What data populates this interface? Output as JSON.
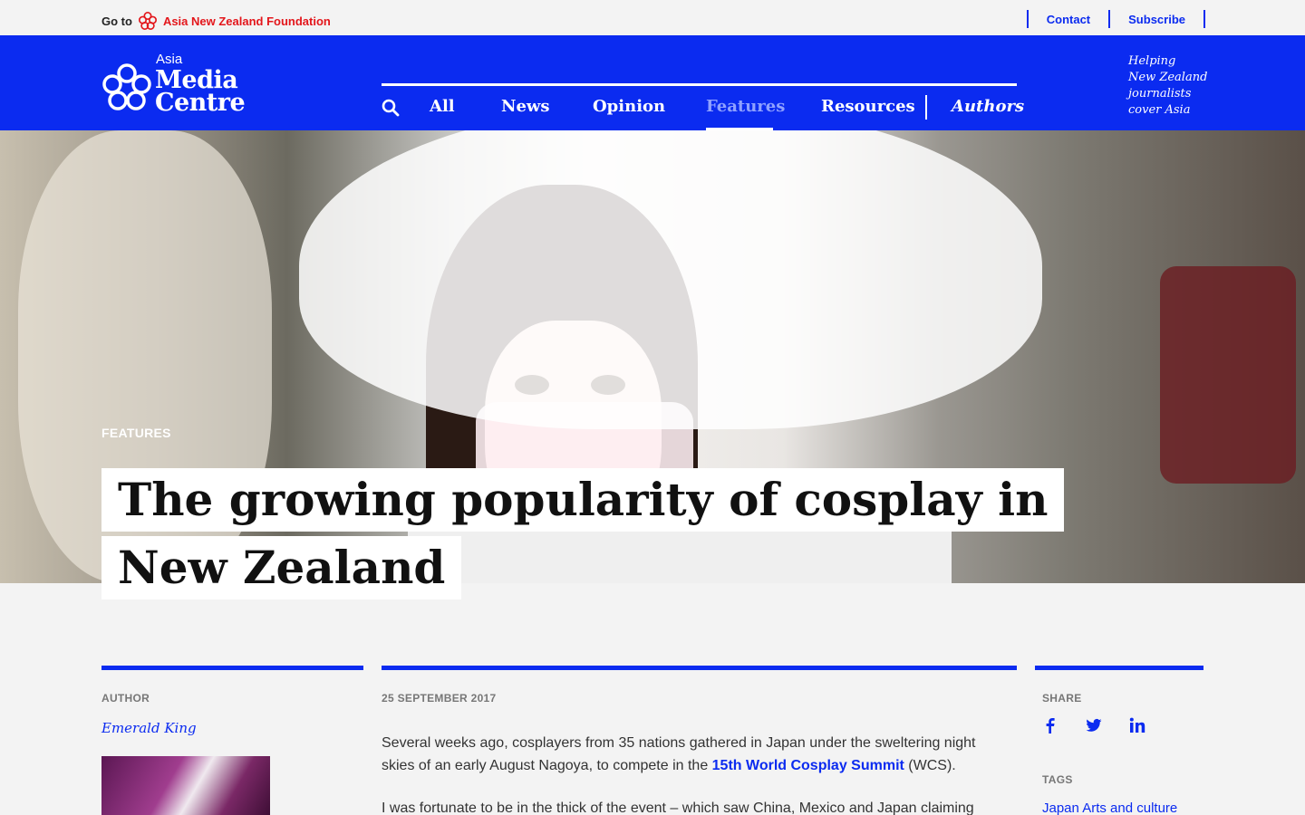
{
  "topbar": {
    "goto_prefix": "Go to",
    "foundation_label": "Asia New Zealand Foundation",
    "contact_label": "Contact",
    "subscribe_label": "Subscribe"
  },
  "logo": {
    "asia": "Asia",
    "media": "Media",
    "centre": "Centre"
  },
  "nav": {
    "items": [
      {
        "label": "All"
      },
      {
        "label": "News"
      },
      {
        "label": "Opinion"
      },
      {
        "label": "Features"
      },
      {
        "label": "Resources"
      },
      {
        "label": "Authors"
      }
    ],
    "active": "Features"
  },
  "tagline": {
    "line1": "Helping",
    "line2": "New Zealand",
    "line3": "journalists",
    "line4": "cover Asia"
  },
  "article": {
    "kicker": "FEATURES",
    "title_line1": "The growing popularity of cosplay in",
    "title_line2": "New Zealand",
    "author_label": "AUTHOR",
    "author_name": "Emerald King",
    "date": "25 SEPTEMBER 2017",
    "para1_pre": "Several weeks ago, cosplayers from 35 nations gathered in Japan under the sweltering night skies of an early August Nagoya, to compete in the ",
    "para1_link": "15th World Cosplay Summit",
    "para1_post": " (WCS).",
    "para2": "I was fortunate to be in the thick of the event – which saw China, Mexico and Japan claiming",
    "share_label": "SHARE",
    "tags_label": "TAGS",
    "tag_partial": "Japan  Arts and culture"
  },
  "colors": {
    "brand_blue": "#0b2bf0",
    "foundation_red": "#e3161b",
    "background": "#f3f3f3"
  },
  "icons": [
    "search-icon",
    "facebook-icon",
    "twitter-icon",
    "linkedin-icon",
    "foundation-flower-icon"
  ]
}
